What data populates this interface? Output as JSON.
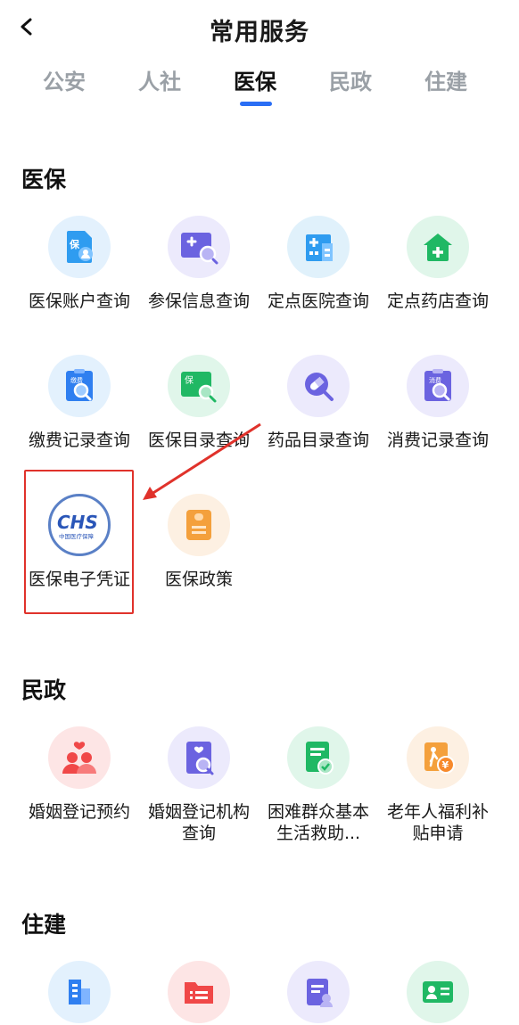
{
  "header": {
    "title": "常用服务"
  },
  "tabs": [
    {
      "label": "公安"
    },
    {
      "label": "人社"
    },
    {
      "label": "医保"
    },
    {
      "label": "民政"
    },
    {
      "label": "住建"
    }
  ],
  "active_tab_index": 2,
  "colors": {
    "accent": "#2a6ef5",
    "annotation_red": "#e0322b"
  },
  "sections": {
    "medical": {
      "title": "医保",
      "items": [
        {
          "label": "医保账户查询",
          "icon": "medical-account-icon"
        },
        {
          "label": "参保信息查询",
          "icon": "insurance-info-search-icon"
        },
        {
          "label": "定点医院查询",
          "icon": "hospital-building-icon"
        },
        {
          "label": "定点药店查询",
          "icon": "pharmacy-house-icon"
        },
        {
          "label": "缴费记录查询",
          "icon": "payment-record-search-icon"
        },
        {
          "label": "医保目录查询",
          "icon": "medical-catalog-search-icon"
        },
        {
          "label": "药品目录查询",
          "icon": "pill-search-icon"
        },
        {
          "label": "消费记录查询",
          "icon": "consumption-record-search-icon"
        },
        {
          "label": "医保电子凭证",
          "icon": "chs-logo-icon"
        },
        {
          "label": "医保政策",
          "icon": "policy-document-icon"
        }
      ]
    },
    "civil": {
      "title": "民政",
      "items": [
        {
          "label": "婚姻登记预约",
          "icon": "couple-heart-icon"
        },
        {
          "label": "婚姻登记机构查询",
          "icon": "marriage-office-search-icon"
        },
        {
          "label": "困难群众基本生活救助...",
          "icon": "relief-document-icon"
        },
        {
          "label": "老年人福利补贴申请",
          "icon": "elderly-subsidy-icon"
        }
      ]
    },
    "housing": {
      "title": "住建",
      "items": [
        {
          "label": "",
          "icon": "building-icon"
        },
        {
          "label": "",
          "icon": "folder-list-icon"
        },
        {
          "label": "",
          "icon": "document-person-icon"
        },
        {
          "label": "",
          "icon": "id-card-icon"
        }
      ]
    }
  },
  "chs_logo": {
    "text": "CHS",
    "subtext": "中国医疗保障"
  }
}
